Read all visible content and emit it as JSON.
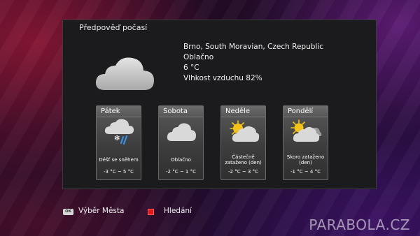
{
  "panel": {
    "title": "Předpověď počasí"
  },
  "current": {
    "icon": "cloud-icon",
    "location": "Brno, South Moravian, Czech Republic",
    "condition": "Oblačno",
    "temperature": "6 °C",
    "humidity": "Vlhkost vzduchu 82%"
  },
  "forecast": [
    {
      "day": "Pátek",
      "icon": "rain-snow-icon",
      "condition": "Déšť se sněhem",
      "temp": "-3 °C ~ 5 °C"
    },
    {
      "day": "Sobota",
      "icon": "cloud-icon",
      "condition": "Oblačno",
      "temp": "-2 °C ~ 1 °C"
    },
    {
      "day": "Neděle",
      "icon": "partly-cloudy-icon",
      "condition": "Částečně zataženo (den)",
      "temp": "-2 °C ~ 3 °C"
    },
    {
      "day": "Pondělí",
      "icon": "mostly-cloudy-icon",
      "condition": "Skoro zataženo (den)",
      "temp": "-1 °C ~ 4 °C"
    }
  ],
  "footer": {
    "ok_key": "OK",
    "select_city": "Výběr Města",
    "search": "Hledání"
  },
  "watermark": "PARABOLA.CZ",
  "colors": {
    "panel_bg": "#1b1b1d",
    "card_bg": "#4a4a4a",
    "red_key": "#e01818",
    "sun": "#f3c21a"
  }
}
